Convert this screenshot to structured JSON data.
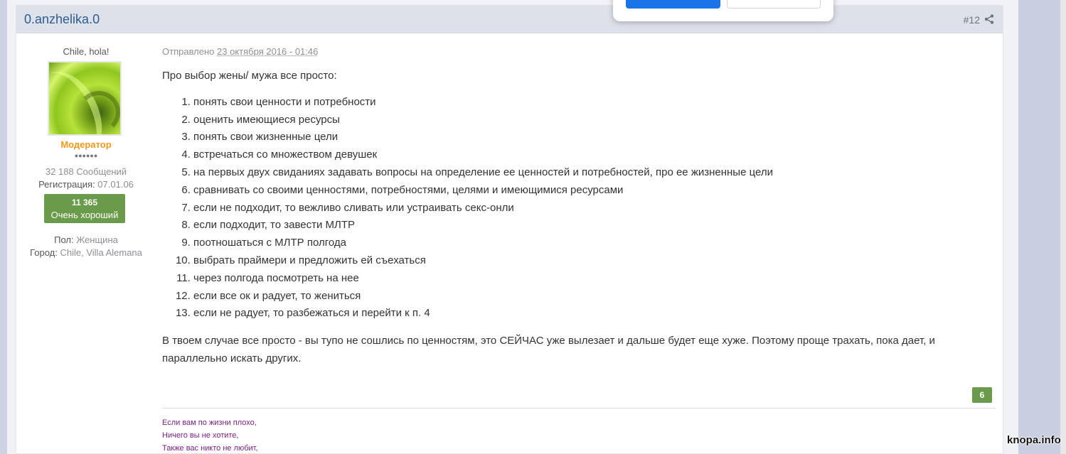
{
  "post": {
    "author": "0.anzhelika.0",
    "number": "#12",
    "sent_label": "Отправлено",
    "date": "23 октября 2016 - 01:46",
    "intro": "Про выбор жены/ мужа все просто:",
    "list": [
      "понять свои ценности и потребности",
      "оценить имеющиеся ресурсы",
      "понять свои жизненные цели",
      "встречаться со множеством девушек",
      "на первых двух свиданиях задавать вопросы на определение ее ценностей и потребностей, про ее жизненные цели",
      "сравнивать со своими ценностями, потребностями, целями и имеющимися ресурсами",
      "если не подходит, то вежливо сливать или устраивать секс-онли",
      "если подходит, то завести МЛТР",
      "поотношаться с МЛТР полгода",
      "выбрать праймери и предложить ей съехаться",
      "через полгода посмотреть на нее",
      "если все ок и радует, то жениться",
      "если не радует, то разбежаться и перейти к п. 4"
    ],
    "outro": "В твоем случае все просто - вы тупо не сошлись по ценностям, это СЕЙЧАС уже вылезает и дальше будет еще хуже. Поэтому проще трахать, пока дает, и параллельно искать других.",
    "reaction_count": "6",
    "signature": [
      "Если вам по жизни плохо,",
      "Ничего вы не хотите,",
      "Также вас никто не любит,"
    ]
  },
  "user": {
    "title": "Chile, hola!",
    "role": "Модератор",
    "rank_dots": "●●●●●●",
    "posts": "32 188 Сообщений",
    "reg_label": "Регистрация: ",
    "reg_date": "07.01.06",
    "rep_value": "11 365",
    "rep_text": "Очень хороший",
    "gender_label": "Пол: ",
    "gender": "Женщина",
    "city_label": "Город: ",
    "city": "Chile, Villa Alemana"
  },
  "watermark": "knopa.info",
  "colors": {
    "author_link": "#2f5c91",
    "role": "#f29a1a",
    "reputation_bg": "#6a9b4a",
    "signature": "#7b1f86",
    "header_bg": "#dde1ea"
  }
}
